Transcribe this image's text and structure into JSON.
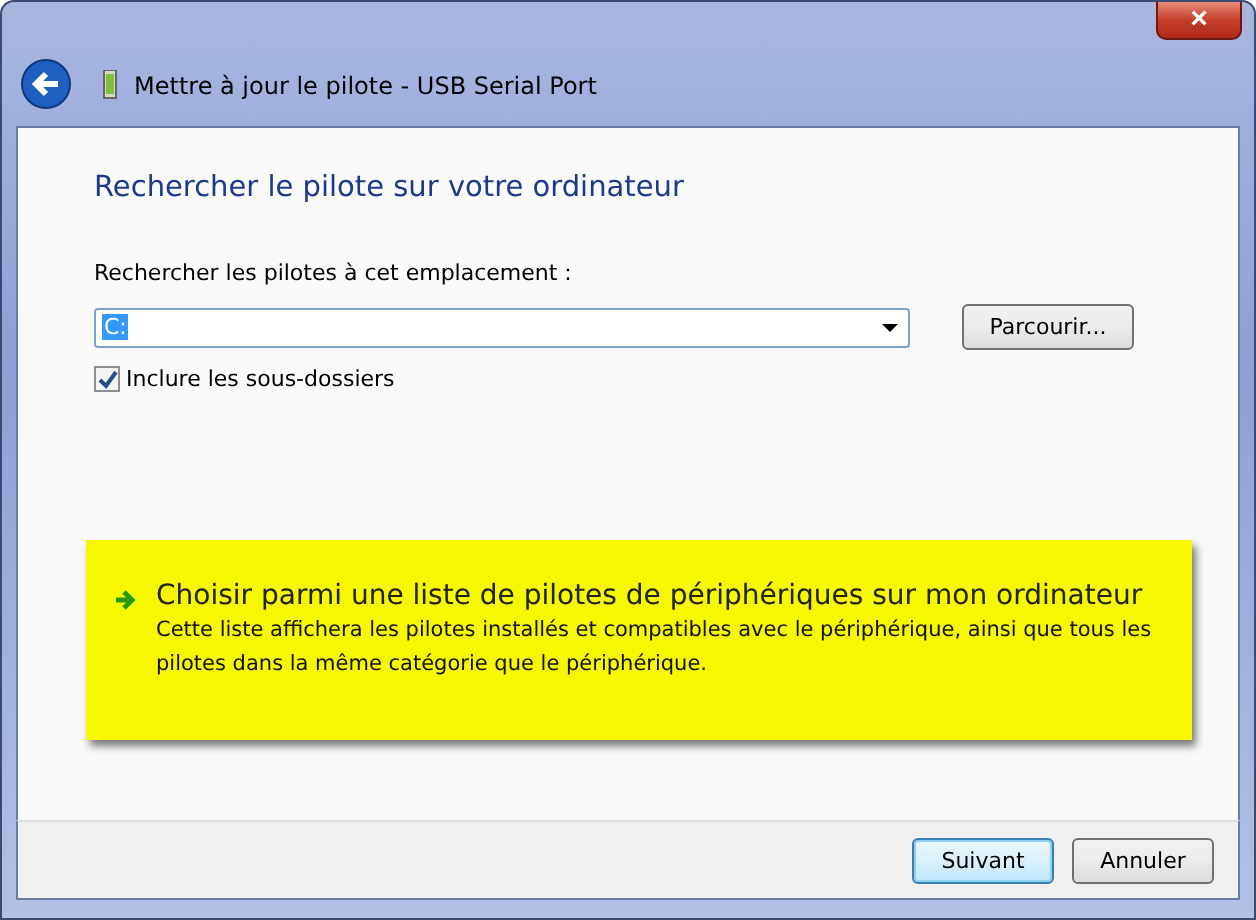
{
  "window": {
    "title": "Mettre à jour le pilote - USB Serial Port",
    "close": "×"
  },
  "heading": "Rechercher le pilote sur votre ordinateur",
  "location": {
    "label": "Rechercher les pilotes à cet emplacement :",
    "value": "C:",
    "browse": "Parcourir..."
  },
  "include_subfolders": {
    "label": "Inclure les sous-dossiers",
    "checked": true
  },
  "option": {
    "title": "Choisir parmi une liste de pilotes de périphériques sur mon ordinateur",
    "description": "Cette liste affichera les pilotes installés et compatibles avec le périphérique, ainsi que tous les pilotes dans la même catégorie que le périphérique."
  },
  "buttons": [
    {
      "label": "Suivant",
      "selected": true
    },
    {
      "label": "Annuler",
      "selected": false
    }
  ]
}
